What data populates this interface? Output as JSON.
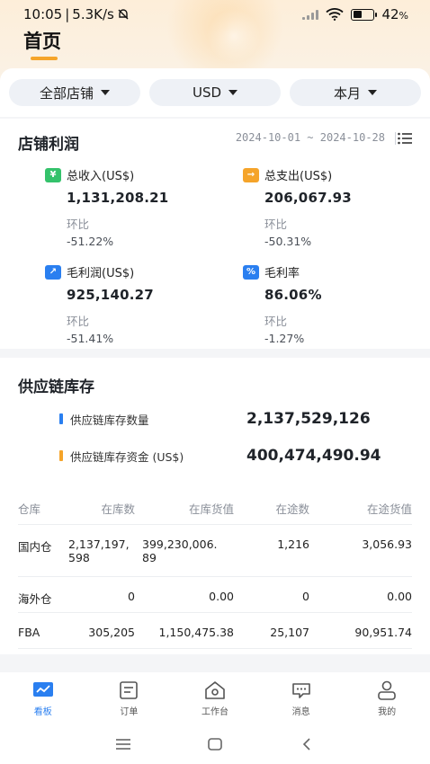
{
  "status_bar": {
    "time": "10:05",
    "speed": "5.3K/s",
    "battery": "42",
    "battery_level": 0.42
  },
  "header": {
    "title": "首页"
  },
  "filters": [
    {
      "label": "全部店铺"
    },
    {
      "label": "USD"
    },
    {
      "label": "本月"
    }
  ],
  "profit_card": {
    "title": "店铺利润",
    "date_range": "2024-10-01 ~ 2024-10-28",
    "metrics": [
      {
        "icon": "yen-icon",
        "badge": "¥",
        "color": "#34c26b",
        "label": "总收入(US$)",
        "value": "1,131,208.21",
        "compare_label": "环比",
        "compare_value": "-51.22%"
      },
      {
        "icon": "arrow-right-icon",
        "badge": "→",
        "color": "#f5a42a",
        "label": "总支出(US$)",
        "value": "206,067.93",
        "compare_label": "环比",
        "compare_value": "-50.31%"
      },
      {
        "icon": "trend-icon",
        "badge": "↗",
        "color": "#2a7ff0",
        "label": "毛利润(US$)",
        "value": "925,140.27",
        "compare_label": "环比",
        "compare_value": "-51.41%"
      },
      {
        "icon": "percent-icon",
        "badge": "%",
        "color": "#2a7ff0",
        "label": "毛利率",
        "value": "86.06%",
        "compare_label": "环比",
        "compare_value": "-1.27%"
      }
    ]
  },
  "supply_card": {
    "title": "供应链库存",
    "summary": [
      {
        "label": "供应链库存数量",
        "value": "2,137,529,126",
        "color": "#2a7ff0"
      },
      {
        "label": "供应链库存资金 (US$)",
        "value": "400,474,490.94",
        "color": "#f5a42a"
      }
    ],
    "table": {
      "headers": [
        "仓库",
        "在库数",
        "在库货值",
        "在途数",
        "在途货值"
      ],
      "rows": [
        [
          "国内仓",
          "2,137,197,\n598",
          "399,230,006.\n89",
          "1,216",
          "3,056.93"
        ],
        [
          "海外仓",
          "0",
          "0.00",
          "0",
          "0.00"
        ],
        [
          "FBA",
          "305,205",
          "1,150,475.38",
          "25,107",
          "90,951.74"
        ]
      ]
    }
  },
  "tabbar": [
    {
      "label": "看板",
      "icon": "dashboard-icon",
      "active": true
    },
    {
      "label": "订单",
      "icon": "order-icon",
      "active": false
    },
    {
      "label": "工作台",
      "icon": "workbench-icon",
      "active": false
    },
    {
      "label": "消息",
      "icon": "message-icon",
      "active": false
    },
    {
      "label": "我的",
      "icon": "profile-icon",
      "active": false
    }
  ],
  "colors": {
    "accent": "#f5a42a",
    "primary": "#2a7ff0"
  }
}
